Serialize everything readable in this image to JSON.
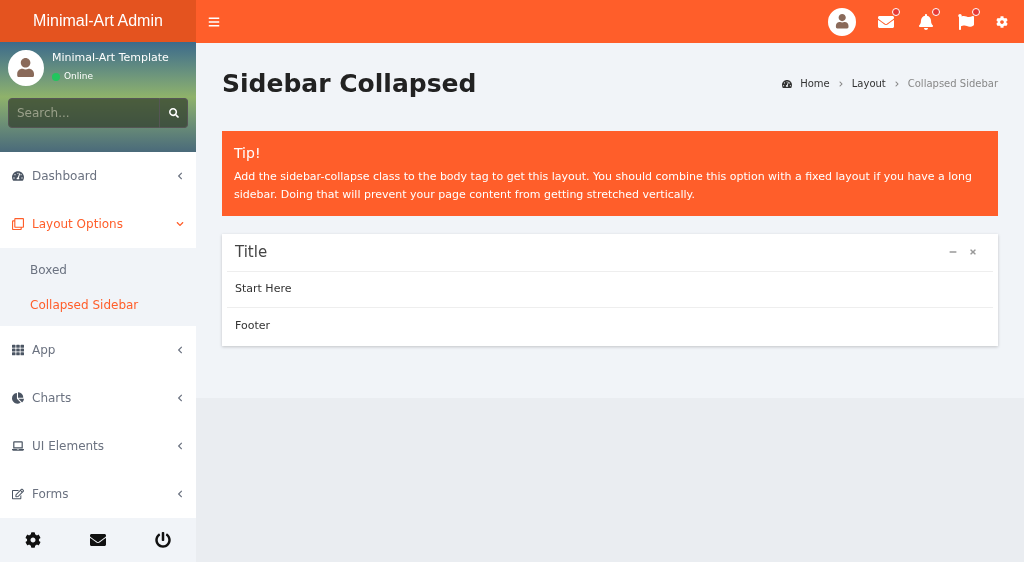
{
  "brand": "Minimal-Art Admin",
  "user": {
    "name": "Minimal-Art Template",
    "status": "Online",
    "online": true
  },
  "search": {
    "placeholder": "Search..."
  },
  "menu": [
    {
      "label": "Dashboard",
      "expanded": false,
      "selected": false
    },
    {
      "label": "Layout Options",
      "expanded": true,
      "selected": true,
      "children": [
        {
          "label": "Boxed",
          "selected": false
        },
        {
          "label": "Collapsed Sidebar",
          "selected": true
        }
      ]
    },
    {
      "label": "App",
      "expanded": false,
      "selected": false
    },
    {
      "label": "Charts",
      "expanded": false,
      "selected": false
    },
    {
      "label": "UI Elements",
      "expanded": false,
      "selected": false
    },
    {
      "label": "Forms",
      "expanded": false,
      "selected": false
    }
  ],
  "page": {
    "title": "Sidebar Collapsed",
    "breadcrumb": [
      "Home",
      "Layout",
      "Collapsed Sidebar"
    ]
  },
  "tip": {
    "title": "Tip!",
    "text": "Add the sidebar-collapse class to the body tag to get this layout. You should combine this option with a fixed layout if you have a long sidebar. Doing that will prevent your page content from getting stretched vertically."
  },
  "box": {
    "title": "Title",
    "body": "Start Here",
    "footer": "Footer"
  }
}
